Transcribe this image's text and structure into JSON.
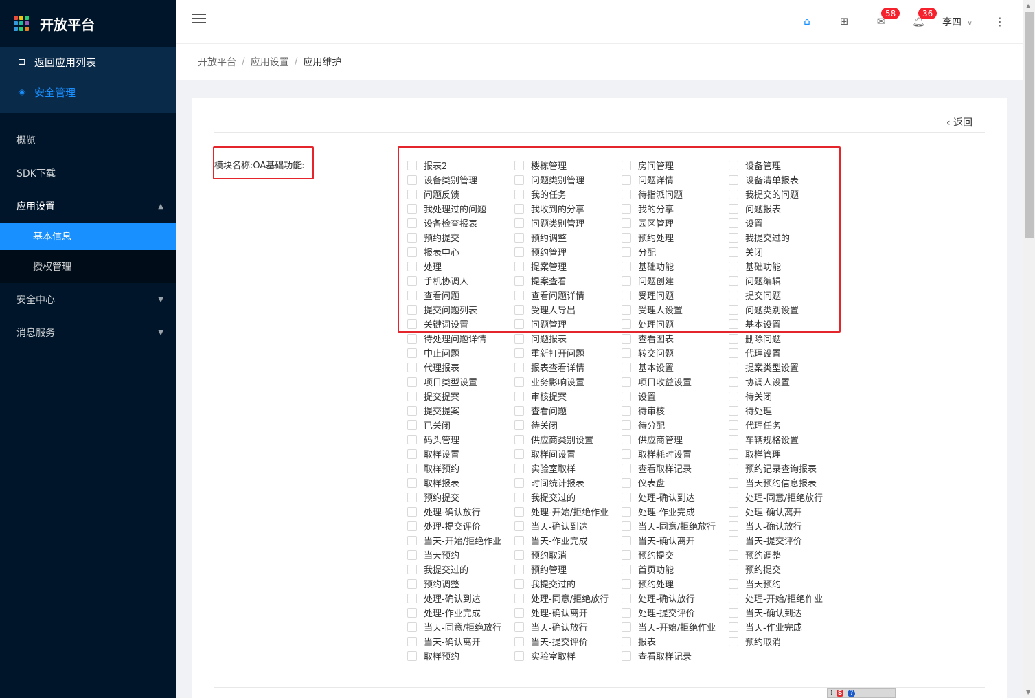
{
  "app": {
    "title": "开放平台"
  },
  "sidebar": {
    "top_items": [
      {
        "label": "返回应用列表",
        "icon": "return-icon"
      },
      {
        "label": "安全管理",
        "icon": "layers-icon"
      }
    ],
    "nav": [
      {
        "label": "概览"
      },
      {
        "label": "SDK下载"
      },
      {
        "label": "应用设置",
        "open": true,
        "children": [
          {
            "label": "基本信息",
            "selected": true
          },
          {
            "label": "授权管理"
          }
        ]
      },
      {
        "label": "安全中心"
      },
      {
        "label": "消息服务"
      }
    ]
  },
  "header": {
    "mail_badge": "58",
    "bell_badge": "36",
    "user": "李四"
  },
  "breadcrumb": [
    "开放平台",
    "应用设置",
    "应用维护"
  ],
  "content": {
    "back_label": "返回",
    "module_label": "模块名称:OA基础功能:",
    "checkboxes": [
      "报表2",
      "楼栋管理",
      "房间管理",
      "设备管理",
      "设备类别管理",
      "问题类别管理",
      "问题详情",
      "设备清单报表",
      "问题反馈",
      "我的任务",
      "待指派问题",
      "我提交的问题",
      "我处理过的问题",
      "我收到的分享",
      "我的分享",
      "问题报表",
      "设备检查报表",
      "问题类别管理",
      "园区管理",
      "设置",
      "预约提交",
      "预约调整",
      "预约处理",
      "我提交过的",
      "报表中心",
      "预约管理",
      "分配",
      "关闭",
      "处理",
      "提案管理",
      "基础功能",
      "基础功能",
      "手机协调人",
      "提案查看",
      "问题创建",
      "问题编辑",
      "查看问题",
      "查看问题详情",
      "受理问题",
      "提交问题",
      "提交问题列表",
      "受理人导出",
      "受理人设置",
      "问题类别设置",
      "关键词设置",
      "问题管理",
      "处理问题",
      "基本设置",
      "待处理问题详情",
      "问题报表",
      "查看图表",
      "删除问题",
      "中止问题",
      "重新打开问题",
      "转交问题",
      "代理设置",
      "代理报表",
      "报表查看详情",
      "基本设置",
      "提案类型设置",
      "项目类型设置",
      "业务影响设置",
      "项目收益设置",
      "协调人设置",
      "提交提案",
      "审核提案",
      "设置",
      "待关闭",
      "提交提案",
      "查看问题",
      "待审核",
      "待处理",
      "已关闭",
      "待关闭",
      "待分配",
      "代理任务",
      "码头管理",
      "供应商类别设置",
      "供应商管理",
      "车辆规格设置",
      "取样设置",
      "取样间设置",
      "取样耗时设置",
      "取样管理",
      "取样预约",
      "实验室取样",
      "查看取样记录",
      "预约记录查询报表",
      "取样报表",
      "时间统计报表",
      "仪表盘",
      "当天预约信息报表",
      "预约提交",
      "我提交过的",
      "处理-确认到达",
      "处理-同意/拒绝放行",
      "处理-确认放行",
      "处理-开始/拒绝作业",
      "处理-作业完成",
      "处理-确认离开",
      "处理-提交评价",
      "当天-确认到达",
      "当天-同意/拒绝放行",
      "当天-确认放行",
      "当天-开始/拒绝作业",
      "当天-作业完成",
      "当天-确认离开",
      "当天-提交评价",
      "当天预约",
      "预约取消",
      "预约提交",
      "预约调整",
      "我提交过的",
      "预约管理",
      "首页功能",
      "预约提交",
      "预约调整",
      "我提交过的",
      "预约处理",
      "当天预约",
      "处理-确认到达",
      "处理-同意/拒绝放行",
      "处理-确认放行",
      "处理-开始/拒绝作业",
      "处理-作业完成",
      "处理-确认离开",
      "处理-提交评价",
      "当天-确认到达",
      "当天-同意/拒绝放行",
      "当天-确认放行",
      "当天-开始/拒绝作业",
      "当天-作业完成",
      "当天-确认离开",
      "当天-提交评价",
      "报表",
      "预约取消",
      "取样预约",
      "实验室取样",
      "查看取样记录"
    ]
  },
  "colors": {
    "sidebar_bg": "#001529",
    "accent": "#1890ff",
    "highlight_border": "#e4262c",
    "badge": "#f5222d"
  }
}
